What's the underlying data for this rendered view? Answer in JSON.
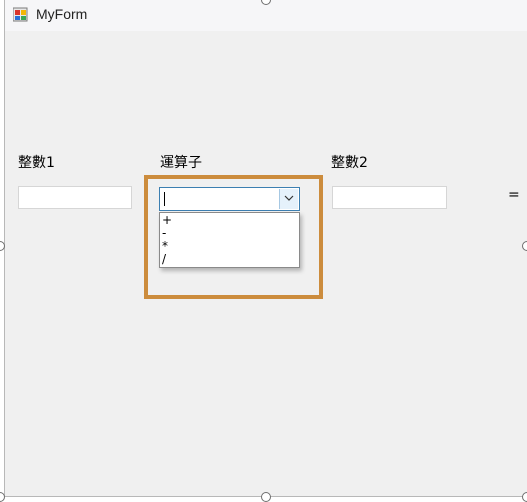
{
  "window": {
    "title": "MyForm",
    "icon": "winform-app-icon"
  },
  "labels": {
    "num1": "整數1",
    "operator": "運算子",
    "num2": "整數2",
    "equals": "="
  },
  "inputs": {
    "num1_value": "",
    "num2_value": ""
  },
  "combo": {
    "value": "",
    "options": [
      "+",
      "-",
      "*",
      "/"
    ]
  },
  "colors": {
    "highlight": "#cc8c3d",
    "combo_focus": "#3c7fb1"
  }
}
